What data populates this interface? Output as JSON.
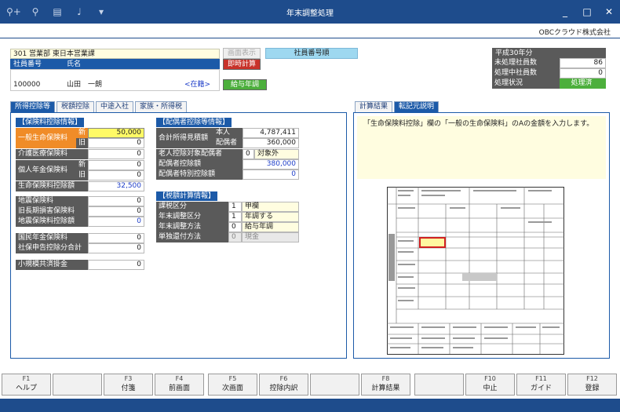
{
  "window": {
    "title": "年末調整処理",
    "minimize": "_",
    "maximize": "□",
    "close": "✕"
  },
  "toolbar_icons": [
    "search-plus-icon",
    "search-icon",
    "print-icon",
    "stamp-icon",
    "dropdown-icon"
  ],
  "company": "OBCクラウド株式会社",
  "employee": {
    "dept": "301 営業部 東日本営業課",
    "no_label": "社員番号",
    "name_label": "氏名",
    "no": "100000",
    "name": "山田　一朗",
    "status": "<在籍>"
  },
  "buttons": {
    "hidden": "画面表示",
    "calc": "即時計算",
    "order": "社員番号順",
    "wage": "給与年調"
  },
  "summary": {
    "year": "平成30年分",
    "rows": [
      {
        "label": "未処理社員数",
        "value": "86"
      },
      {
        "label": "処理中社員数",
        "value": "0"
      },
      {
        "label": "処理状況",
        "value": "処理済"
      }
    ]
  },
  "tabs_left": [
    "所得控除等",
    "税額控除",
    "中途入社",
    "家族・所得税"
  ],
  "tabs_right": [
    "計算結果",
    "転記元説明"
  ],
  "insurance": {
    "header": "【保険料控除情報】",
    "ippan": "一般生命保険料",
    "new": "新",
    "old": "旧",
    "ippan_new": "50,000",
    "ippan_old": "0",
    "kaigo": "介護医療保険料",
    "kaigo_val": "0",
    "kojin": "個人年金保険料",
    "kojin_new": "0",
    "kojin_old": "0",
    "seimei_total": "生命保険料控除額",
    "seimei_total_val": "32,500",
    "jishin": "地震保険料",
    "jishin_val": "0",
    "kyuchoki": "旧長期損害保険料",
    "kyuchoki_val": "0",
    "jishin_total": "地震保険料控除額",
    "jishin_total_val": "0",
    "kokumin": "国民年金保険料",
    "kokumin_val": "0",
    "shaho": "社保申告控除分合計",
    "shaho_val": "0",
    "shokibo": "小規模共済掛金",
    "shokibo_val": "0"
  },
  "spouse": {
    "header": "【配偶者控除等情報】",
    "gokei": "合計所得見積額",
    "honnin": "本人",
    "honnin_val": "4,787,411",
    "haigusha": "配偶者",
    "haigusha_val": "360,000",
    "rojin": "老人控除対象配偶者",
    "rojin_code": "0",
    "rojin_text": "対象外",
    "kojo": "配偶者控除額",
    "kojo_val": "380,000",
    "tokubetsu": "配偶者特別控除額",
    "tokubetsu_val": "0"
  },
  "tax": {
    "header": "【税額計算情報】",
    "rows": [
      {
        "label": "課税区分",
        "code": "1",
        "text": "甲欄"
      },
      {
        "label": "年末調整区分",
        "code": "1",
        "text": "年調する"
      },
      {
        "label": "年末調整方法",
        "code": "0",
        "text": "給与年調"
      },
      {
        "label": "単独還付方法",
        "code": "0",
        "text": "現金"
      }
    ]
  },
  "explanation": "「生命保険料控除」欄の「一般の生命保険料」のAの金額を入力します。",
  "fkeys": [
    {
      "n": "F1",
      "label": "ヘルプ"
    },
    {
      "n": "",
      "label": ""
    },
    {
      "n": "F3",
      "label": "付箋"
    },
    {
      "n": "F4",
      "label": "前画面"
    },
    {
      "n": "F5",
      "label": "次画面"
    },
    {
      "n": "F6",
      "label": "控除内訳"
    },
    {
      "n": "",
      "label": ""
    },
    {
      "n": "F8",
      "label": "計算結果"
    },
    {
      "n": "",
      "label": ""
    },
    {
      "n": "F10",
      "label": "中止"
    },
    {
      "n": "F11",
      "label": "ガイド"
    },
    {
      "n": "F12",
      "label": "登録"
    }
  ]
}
